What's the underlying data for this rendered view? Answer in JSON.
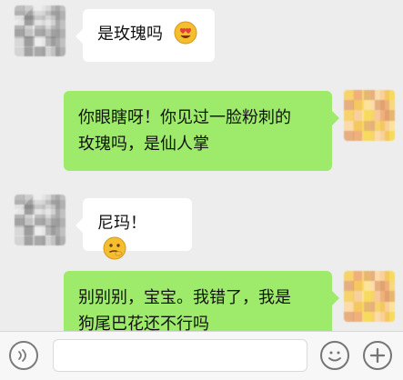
{
  "messages": [
    {
      "side": "left",
      "text": "是玫瑰吗",
      "emoji": "heart-eyes-icon"
    },
    {
      "side": "right",
      "text_lines": [
        "你眼瞎呀！你见过一脸粉刺的",
        "玫瑰吗，是仙人掌"
      ]
    },
    {
      "side": "left",
      "text": "尼玛！",
      "emoji": "thinking-face-icon"
    },
    {
      "side": "right",
      "text_lines": [
        "别别别，宝宝。我错了，我是",
        "狗尾巴花还不行吗"
      ]
    }
  ],
  "input_bar": {
    "voice_icon": "voice-icon",
    "emoji_icon": "emoji-icon",
    "plus_icon": "plus-icon"
  },
  "colors": {
    "chat_bg": "#ededed",
    "green_bubble": "#9eea6a",
    "white_bubble": "#ffffff"
  }
}
